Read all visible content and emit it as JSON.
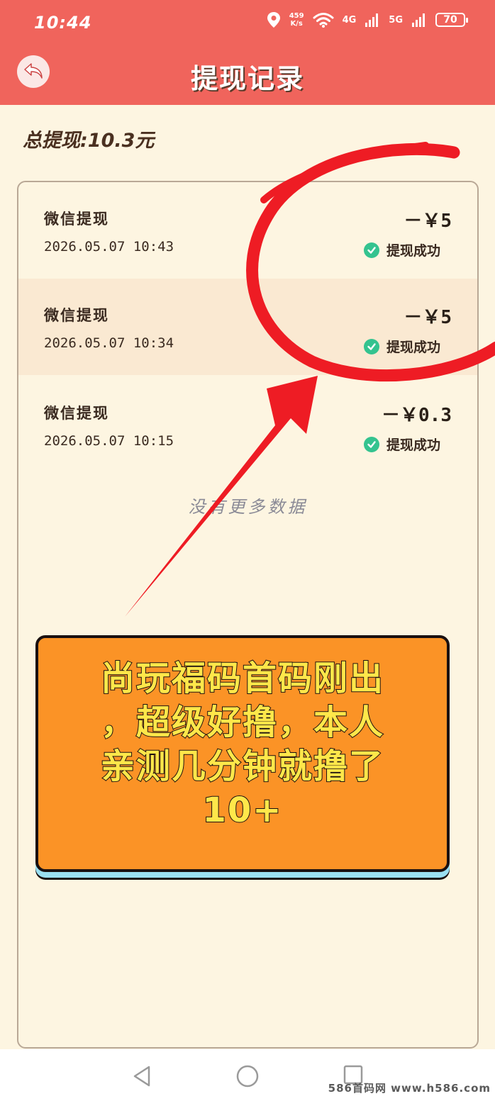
{
  "status_bar": {
    "time": "10:44",
    "speed_value": "459",
    "speed_unit": "K/s",
    "net1": "4G",
    "net2": "5G",
    "battery": "70"
  },
  "header": {
    "title": "提现记录"
  },
  "summary": {
    "total": "总提现:10.3元"
  },
  "records": [
    {
      "type": "微信提现",
      "time": "2026.05.07 10:43",
      "amount": "－￥5",
      "status": "提现成功"
    },
    {
      "type": "微信提现",
      "time": "2026.05.07 10:34",
      "amount": "－￥5",
      "status": "提现成功"
    },
    {
      "type": "微信提现",
      "time": "2026.05.07 10:15",
      "amount": "－￥0.3",
      "status": "提现成功"
    }
  ],
  "footer_note": "没有更多数据",
  "promo": {
    "lines": [
      "尚玩福码首码刚出",
      "，超级好撸，本人",
      "亲测几分钟就撸了",
      "10+"
    ]
  },
  "watermark": "586首码网 www.h586.com",
  "colors": {
    "header": "#f0645c",
    "background": "#fdf5e1",
    "alt_row": "#fae9d2",
    "annotation": "#ee1c24",
    "promo_fill": "#fb9326",
    "promo_text": "#ffe74a",
    "success": "#34c38f"
  },
  "icons": {
    "back": "back-arrow-icon",
    "location": "location-icon",
    "wifi": "wifi-icon",
    "signal": "signal-bars-icon",
    "success": "check-circle-icon"
  }
}
